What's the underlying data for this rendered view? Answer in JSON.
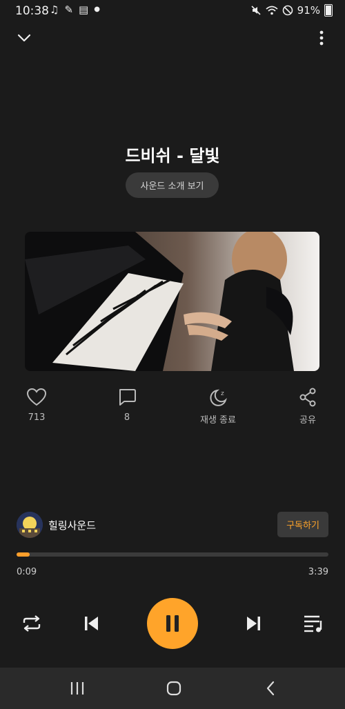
{
  "status": {
    "time": "10:38",
    "battery": "91%",
    "left_icons": [
      "music-note-icon",
      "feather-icon",
      "news-icon",
      "dot-icon"
    ],
    "right_icons": [
      "mute-icon",
      "wifi-icon",
      "do-not-disturb-icon",
      "battery-icon"
    ]
  },
  "header": {
    "collapse_icon": "chevron-down-icon",
    "more_icon": "more-vertical-icon"
  },
  "track": {
    "title": "드비쉬 - 달빛",
    "intro_button": "사운드 소개 보기"
  },
  "actions": [
    {
      "icon": "heart-icon",
      "label": "713"
    },
    {
      "icon": "comment-icon",
      "label": "8"
    },
    {
      "icon": "sleep-timer-icon",
      "label": "재생 종료"
    },
    {
      "icon": "share-icon",
      "label": "공유"
    }
  ],
  "channel": {
    "name": "힐링사운드",
    "subscribe_label": "구독하기"
  },
  "player": {
    "current_time": "0:09",
    "duration": "3:39",
    "progress_fraction": 0.041,
    "controls": [
      "repeat-icon",
      "previous-icon",
      "pause-icon",
      "next-icon",
      "playlist-icon"
    ]
  },
  "colors": {
    "accent": "#ffa42a",
    "background": "#1b1b1b",
    "button_bg": "#3a3a3a"
  }
}
